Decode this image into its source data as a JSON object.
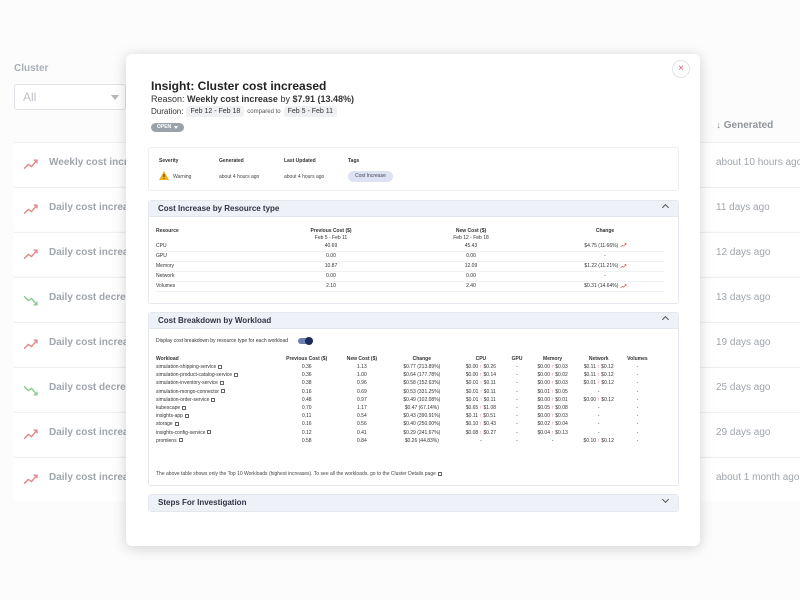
{
  "background": {
    "cluster_label": "Cluster",
    "cluster_select_value": "All",
    "generated_header": "Generated",
    "rows": [
      {
        "name": "Weekly cost increa",
        "time": "about 10 hours ago",
        "trend": "up"
      },
      {
        "name": "Daily cost increase",
        "time": "11 days ago",
        "trend": "up"
      },
      {
        "name": "Daily cost increase",
        "time": "12 days ago",
        "trend": "up"
      },
      {
        "name": "Daily cost decrease",
        "time": "13 days ago",
        "trend": "down"
      },
      {
        "name": "Daily cost increase",
        "time": "19 days ago",
        "trend": "up"
      },
      {
        "name": "Daily cost decrease",
        "time": "25 days ago",
        "trend": "down"
      },
      {
        "name": "Daily cost increase",
        "time": "29 days ago",
        "trend": "up"
      },
      {
        "name": "Daily cost increase",
        "time": "about 1 month ago",
        "trend": "up"
      }
    ]
  },
  "modal": {
    "close_icon": "×",
    "title": "Insight: Cluster cost increased",
    "reason_label": "Reason:",
    "reason_text": "Weekly cost increase",
    "reason_by": "by",
    "reason_amount": "$7.91 (13.48%)",
    "duration_label": "Duration:",
    "duration_current": "Feb 12 - Feb 18",
    "compared_to": "compared to",
    "duration_previous": "Feb 5 - Feb 11",
    "status": "OPEN",
    "summary": {
      "severity_label": "Severity",
      "severity_value": "Warning",
      "generated_label": "Generated",
      "generated_value": "about 4 hours ago",
      "updated_label": "Last Updated",
      "updated_value": "about 4 hours ago",
      "tags_label": "Tags",
      "tag_value": "Cost Increase"
    },
    "resource_section": {
      "title": "Cost Increase by Resource type",
      "headers": {
        "resource": "Resource",
        "previous": "Previous Cost ($)",
        "previous_range": "Feb 5 - Feb 11",
        "new": "New Cost ($)",
        "new_range": "Feb 12 - Feb 18",
        "change": "Change"
      },
      "rows": [
        {
          "resource": "CPU",
          "previous": "40.69",
          "new": "45.43",
          "change": "$4.75 (11.66%)",
          "trend": true
        },
        {
          "resource": "GPU",
          "previous": "0.00",
          "new": "0.00",
          "change": "-",
          "trend": false
        },
        {
          "resource": "Memory",
          "previous": "10.87",
          "new": "12.09",
          "change": "$1.22 (11.21%)",
          "trend": true
        },
        {
          "resource": "Network",
          "previous": "0.00",
          "new": "0.00",
          "change": "-",
          "trend": false
        },
        {
          "resource": "Volumes",
          "previous": "2.10",
          "new": "2.40",
          "change": "$0.31 (14.64%)",
          "trend": true
        }
      ]
    },
    "workload_section": {
      "title": "Cost Breakdown by Workload",
      "toggle_label": "Display cost breakdown by resource type for each workload",
      "headers": [
        "Workload",
        "Previous Cost ($)",
        "New Cost ($)",
        "Change",
        "CPU",
        "GPU",
        "Memory",
        "Network",
        "Volumes"
      ],
      "rows": [
        {
          "workload": "simulation-shipping-service",
          "prev": "0.36",
          "new": "1.13",
          "change": "$0.77 (213.89%)",
          "cpu": "$0.00 ↑ $0.26",
          "gpu": "-",
          "memory": "$0.00 ↑ $0.03",
          "network": "$0.11 ↑ $0.12",
          "volumes": "-"
        },
        {
          "workload": "simulation-product-catalog-service",
          "prev": "0.36",
          "new": "1.00",
          "change": "$0.64 (177.78%)",
          "cpu": "$0.00 ↑ $0.14",
          "gpu": "-",
          "memory": "$0.00 ↑ $0.02",
          "network": "$0.11 ↑ $0.12",
          "volumes": "-"
        },
        {
          "workload": "simulation-inventory-service",
          "prev": "0.38",
          "new": "0.96",
          "change": "$0.58 (152.63%)",
          "cpu": "$0.01 ↑ $0.11",
          "gpu": "-",
          "memory": "$0.00 ↑ $0.03",
          "network": "$0.01 ↑ $0.12",
          "volumes": "-"
        },
        {
          "workload": "simulation-mongo-connector",
          "prev": "0.16",
          "new": "0.69",
          "change": "$0.53 (331.25%)",
          "cpu": "$0.01 ↑ $0.11",
          "gpu": "-",
          "memory": "$0.01 ↑ $0.05",
          "network": "-",
          "volumes": "-"
        },
        {
          "workload": "simulation-order-service",
          "prev": "0.48",
          "new": "0.97",
          "change": "$0.49 (102.08%)",
          "cpu": "$0.01 ↑ $0.11",
          "gpu": "-",
          "memory": "$0.00 ↑ $0.01",
          "network": "$0.00 ↑ $0.12",
          "volumes": "-"
        },
        {
          "workload": "kubescape",
          "prev": "0.70",
          "new": "1.17",
          "change": "$0.47 (67.14%)",
          "cpu": "$0.65 ↑ $1.08",
          "gpu": "-",
          "memory": "$0.05 ↑ $0.08",
          "network": "-",
          "volumes": "-"
        },
        {
          "workload": "insights-app",
          "prev": "0.11",
          "new": "0.54",
          "change": "$0.43 (390.91%)",
          "cpu": "$0.11 ↑ $0.51",
          "gpu": "-",
          "memory": "$0.00 ↑ $0.03",
          "network": "-",
          "volumes": "-"
        },
        {
          "workload": "storage",
          "prev": "0.16",
          "new": "0.56",
          "change": "$0.40 (250.00%)",
          "cpu": "$0.10 ↑ $0.43",
          "gpu": "-",
          "memory": "$0.02 ↑ $0.04",
          "network": "-",
          "volumes": "-"
        },
        {
          "workload": "insights-config-service",
          "prev": "0.12",
          "new": "0.41",
          "change": "$0.29 (241.67%)",
          "cpu": "$0.08 ↑ $0.27",
          "gpu": "-",
          "memory": "$0.04 ↑ $0.13",
          "network": "-",
          "volumes": "-"
        },
        {
          "workload": "promlens",
          "prev": "0.58",
          "new": "0.84",
          "change": "$0.26 (44.83%)",
          "cpu": "-",
          "gpu": "-",
          "memory": "-",
          "network": "$0.10 ↑ $0.12",
          "volumes": "-"
        }
      ],
      "footnote": "The above table shows only the Top 10 Workloads (highest increases). To see all the workloads, go to the Cluster Details page"
    },
    "steps_section": {
      "title": "Steps For Investigation"
    }
  },
  "colors": {
    "accent": "#1f2b59",
    "increase": "#d24a4a",
    "decrease": "#4caf50"
  }
}
